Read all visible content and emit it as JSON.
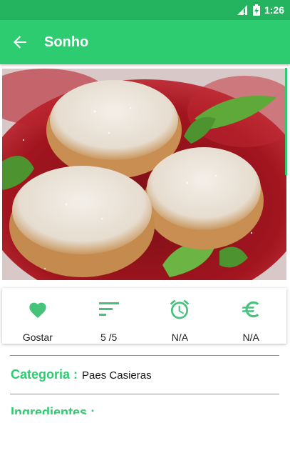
{
  "status_bar": {
    "time": "1:26",
    "icons": [
      "signal-icon",
      "battery-charging-icon"
    ]
  },
  "toolbar": {
    "title": "Sonho",
    "back_icon": "arrow-back-icon"
  },
  "hero": {
    "image": "sugared-doughnuts-photo"
  },
  "actions": [
    {
      "name": "like",
      "icon": "heart-icon",
      "label": "Gostar"
    },
    {
      "name": "difficulty",
      "icon": "sort-icon",
      "label": "5 /5"
    },
    {
      "name": "time",
      "icon": "alarm-icon",
      "label": "N/A"
    },
    {
      "name": "price",
      "icon": "euro-icon",
      "label": "N/A"
    }
  ],
  "details": {
    "category_label": "Categoria :",
    "category_value": "Paes Casieras",
    "ingredients_label": "Ingredientes :"
  },
  "colors": {
    "status_bar": "#24b35f",
    "toolbar": "#2ecc71",
    "accent": "#2ecc71",
    "icon": "#47c27b"
  }
}
